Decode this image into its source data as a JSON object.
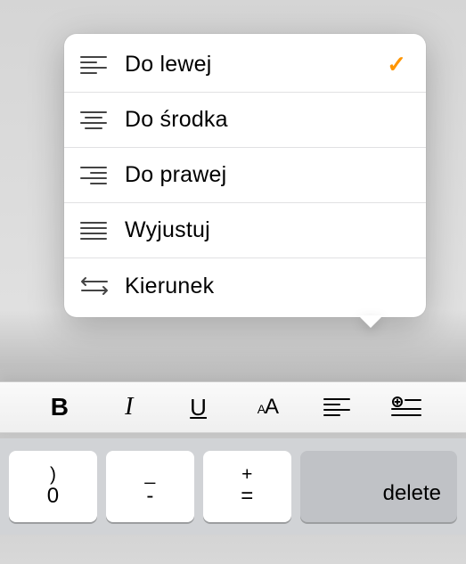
{
  "menu": {
    "items": [
      {
        "label": "Do lewej",
        "icon": "align-left-icon",
        "selected": true
      },
      {
        "label": "Do środka",
        "icon": "align-center-icon",
        "selected": false
      },
      {
        "label": "Do prawej",
        "icon": "align-right-icon",
        "selected": false
      },
      {
        "label": "Wyjustuj",
        "icon": "align-justify-icon",
        "selected": false
      },
      {
        "label": "Kierunek",
        "icon": "direction-arrows-icon",
        "selected": false
      }
    ],
    "checkmark": "✓"
  },
  "toolbar": {
    "bold": "B",
    "italic": "I",
    "underline": "U",
    "text_size": "AA"
  },
  "keyboard": {
    "keys": [
      {
        "upper": ")",
        "lower": "0"
      },
      {
        "upper": "_",
        "lower": "-"
      },
      {
        "upper": "+",
        "lower": "="
      }
    ],
    "delete": "delete"
  },
  "colors": {
    "accent": "#ff9500"
  }
}
